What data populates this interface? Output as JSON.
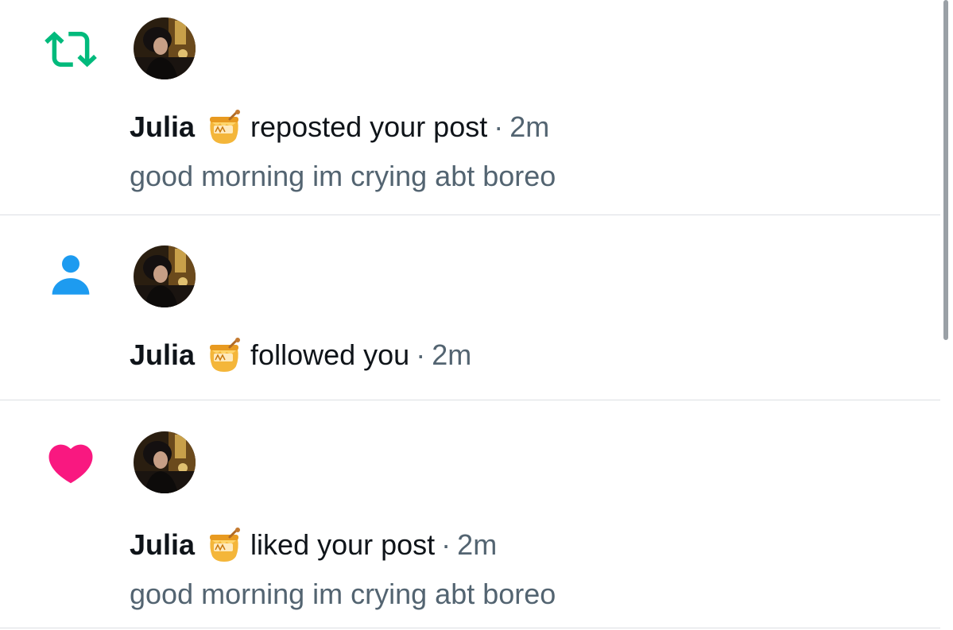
{
  "colors": {
    "repost": "#00ba7c",
    "follow": "#1d9bf0",
    "like": "#f91880",
    "primary_text": "#0f1419",
    "secondary_text": "#536471"
  },
  "notifications": [
    {
      "type_icon": "repost-icon",
      "avatar": "profile-photo",
      "name": "Julia",
      "badge_icon": "honey-pot-icon",
      "action": "reposted your post",
      "separator": "·",
      "time": "2m",
      "snippet": "good morning im crying abt boreo"
    },
    {
      "type_icon": "person-icon",
      "avatar": "profile-photo",
      "name": "Julia",
      "badge_icon": "honey-pot-icon",
      "action": "followed you",
      "separator": "·",
      "time": "2m"
    },
    {
      "type_icon": "heart-icon",
      "avatar": "profile-photo",
      "name": "Julia",
      "badge_icon": "honey-pot-icon",
      "action": "liked your post",
      "separator": "·",
      "time": "2m",
      "snippet": "good morning im crying abt boreo"
    }
  ]
}
